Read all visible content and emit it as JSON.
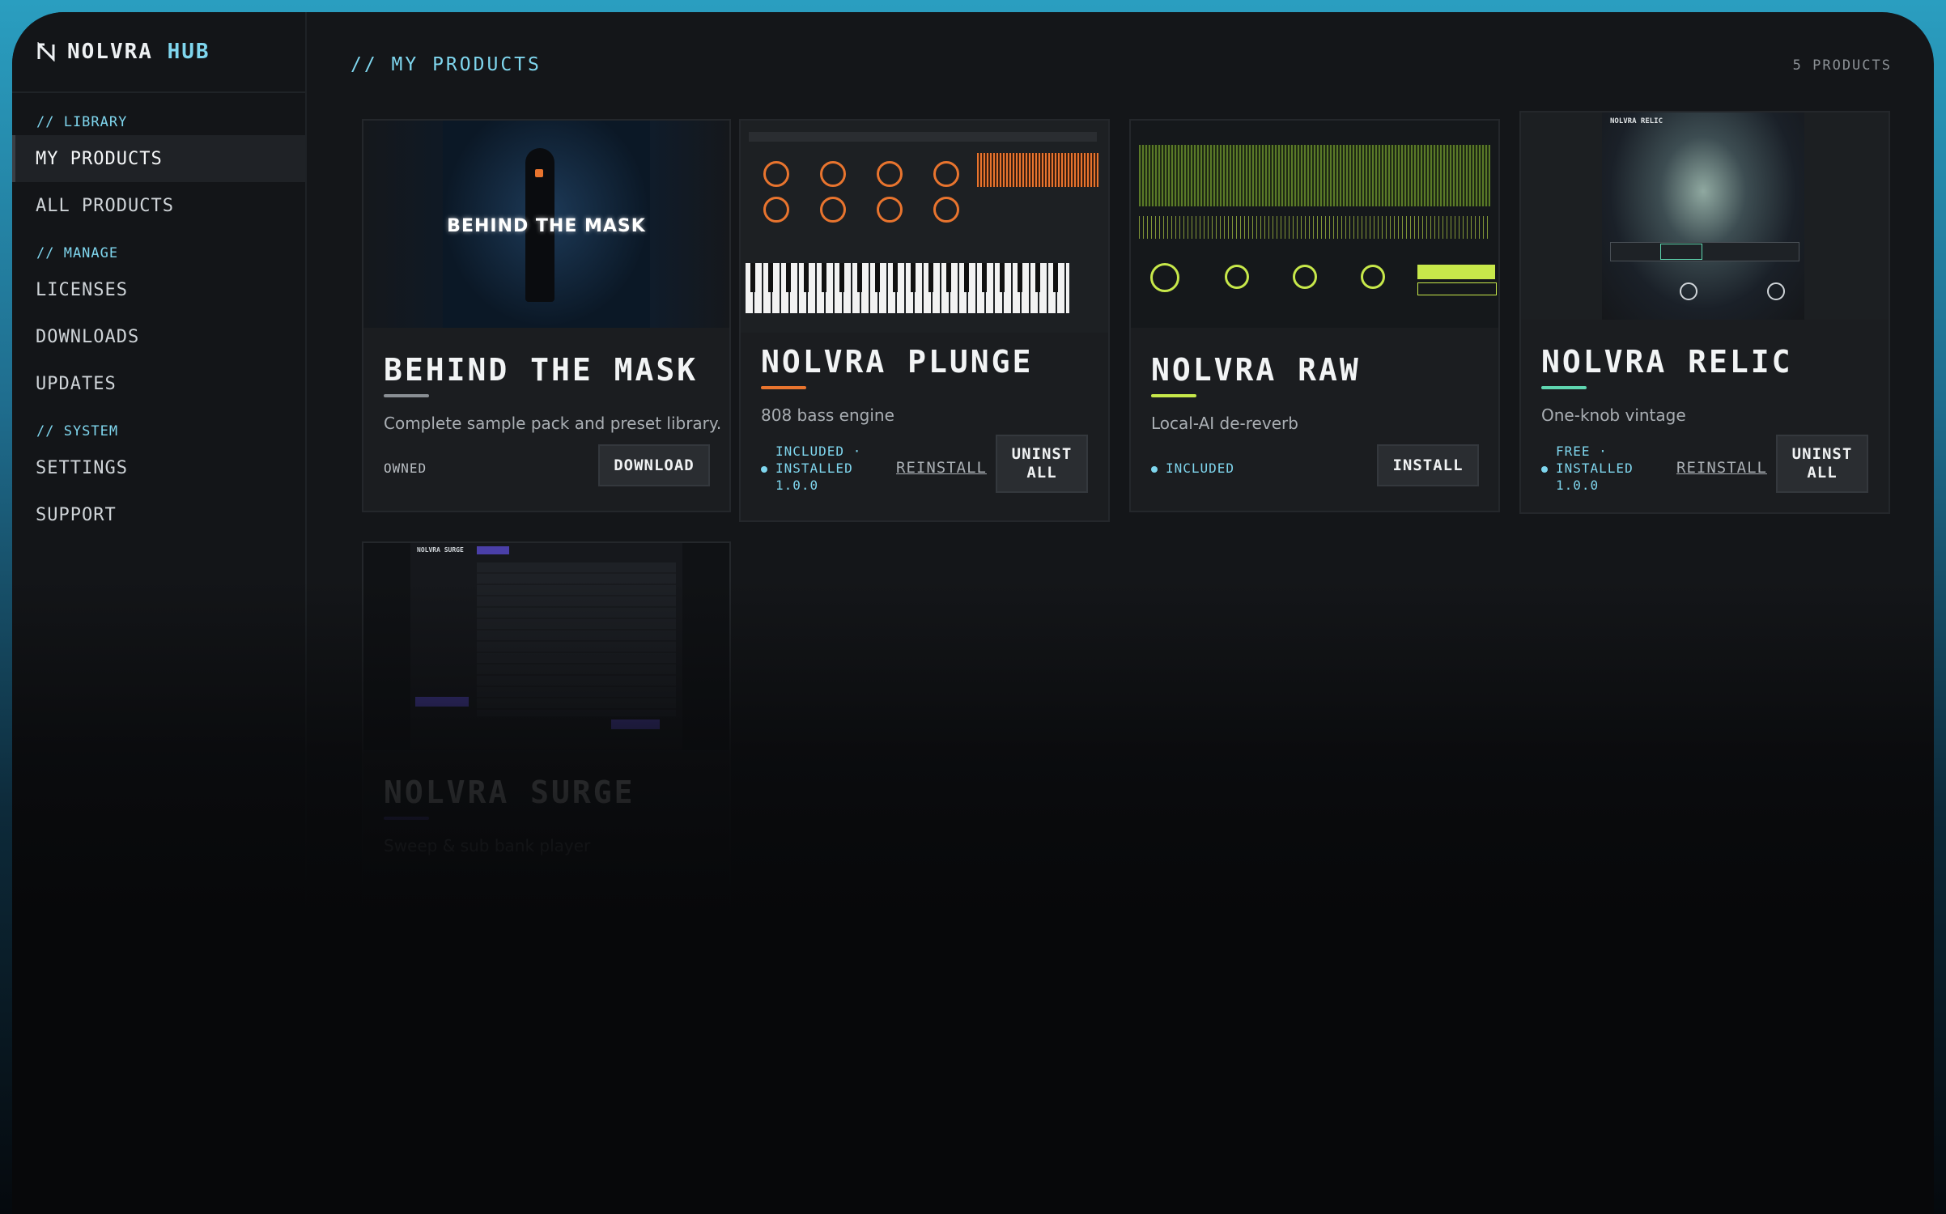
{
  "brand": {
    "name": "NOLVRA",
    "suffix": "HUB"
  },
  "sidebar": {
    "sections": [
      {
        "label": "// LIBRARY",
        "items": [
          {
            "label": "MY PRODUCTS"
          },
          {
            "label": "ALL PRODUCTS"
          }
        ]
      },
      {
        "label": "// MANAGE",
        "items": [
          {
            "label": "LICENSES"
          },
          {
            "label": "DOWNLOADS"
          },
          {
            "label": "UPDATES"
          }
        ]
      },
      {
        "label": "// SYSTEM",
        "items": [
          {
            "label": "SETTINGS"
          },
          {
            "label": "SUPPORT"
          }
        ]
      }
    ]
  },
  "main": {
    "title": "// MY PRODUCTS",
    "count": "5 PRODUCTS",
    "products": [
      {
        "name": "BEHIND THE MASK",
        "description": "Complete sample pack and preset library.",
        "status": "OWNED",
        "primary_action": "DOWNLOAD",
        "accent": "#8a8f94",
        "thumb_text": "BEHIND THE MASK"
      },
      {
        "name": "NOLVRA PLUNGE",
        "description": "808 bass engine",
        "status_line1": "INCLUDED ·",
        "status_line2": "INSTALLED",
        "status_line3": "1.0.0",
        "secondary_action": "REINSTALL",
        "primary_action_line1": "UNINST",
        "primary_action_line2": "ALL",
        "accent": "#e8742e"
      },
      {
        "name": "NOLVRA RAW",
        "description": "Local-AI de-reverb",
        "status": "INCLUDED",
        "primary_action": "INSTALL",
        "accent": "#c7e84a"
      },
      {
        "name": "NOLVRA RELIC",
        "description": "One-knob vintage",
        "status_line1": "FREE ·",
        "status_line2": "INSTALLED",
        "status_line3": "1.0.0",
        "secondary_action": "REINSTALL",
        "primary_action_line1": "UNINST",
        "primary_action_line2": "ALL",
        "accent": "#5fd6b0",
        "thumb_brand": "NOLVRA RELIC"
      },
      {
        "name": "NOLVRA SURGE",
        "description": "Sweep & sub bank player",
        "accent": "#6a5ae0",
        "thumb_brand": "NOLVRA SURGE"
      }
    ]
  }
}
